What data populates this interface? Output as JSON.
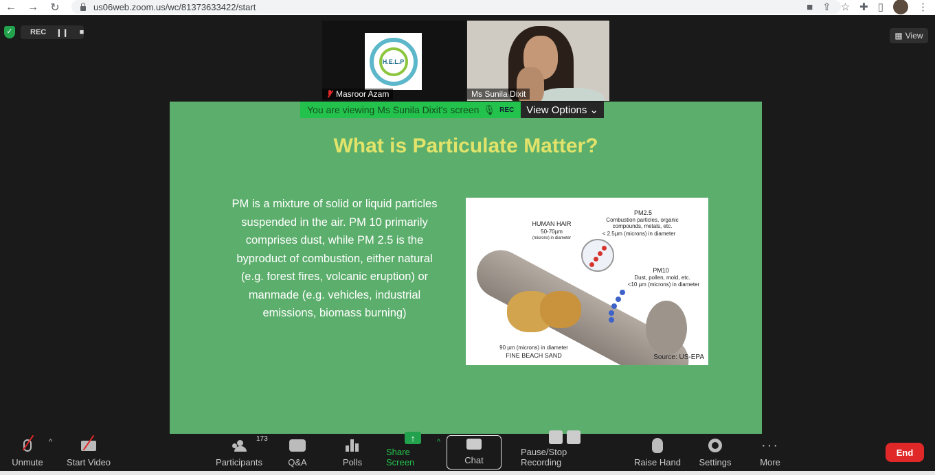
{
  "browser": {
    "url": "us06web.zoom.us/wc/81373633422/start",
    "icons": [
      "back-icon",
      "forward-icon",
      "reload-icon",
      "camera-icon",
      "share-icon",
      "star-icon",
      "extensions-icon",
      "sidepanel-icon",
      "profile-avatar",
      "menu-icon"
    ]
  },
  "meeting": {
    "rec_label": "REC",
    "view_label": "View",
    "participants_tiles": [
      {
        "name": "Masroor Azam",
        "muted": true
      },
      {
        "name": "Ms Sunila Dixit",
        "muted": false
      }
    ],
    "logo_text": "H.E.L.P",
    "viewing_text": "You are viewing Ms Sunila Dixit's screen",
    "viewing_rec": "REC",
    "view_options": "View Options"
  },
  "slide": {
    "title": "What is Particulate Matter?",
    "body": "PM is a mixture of solid or liquid particles suspended in the air. PM 10 primarily comprises dust, while PM 2.5 is the byproduct of combustion, either natural (e.g. forest fires, volcanic eruption) or manmade (e.g. vehicles, industrial emissions, biomass burning)",
    "image": {
      "human_hair": "HUMAN HAIR",
      "human_hair_size": "50-70µm",
      "human_hair_unit": "(microns) in diameter",
      "pm25_label": "PM2.5",
      "pm25_desc": "Combustion particles, organic compounds, metals, etc.",
      "pm25_size": "< 2.5µm (microns) in diameter",
      "pm10_label": "PM10",
      "pm10_desc": "Dust, pollen, mold, etc.",
      "pm10_size": "<10 µm (microns) in diameter",
      "sand_size": "90 µm (microns) in diameter",
      "sand_label": "FINE BEACH SAND",
      "source": "Source: US-EPA"
    }
  },
  "toolbar": {
    "unmute": "Unmute",
    "start_video": "Start Video",
    "participants": "Participants",
    "participants_count": "173",
    "qa": "Q&A",
    "polls": "Polls",
    "share_screen": "Share Screen",
    "chat": "Chat",
    "pause_stop": "Pause/Stop Recording",
    "raise_hand": "Raise Hand",
    "settings": "Settings",
    "more": "More",
    "end": "End"
  }
}
